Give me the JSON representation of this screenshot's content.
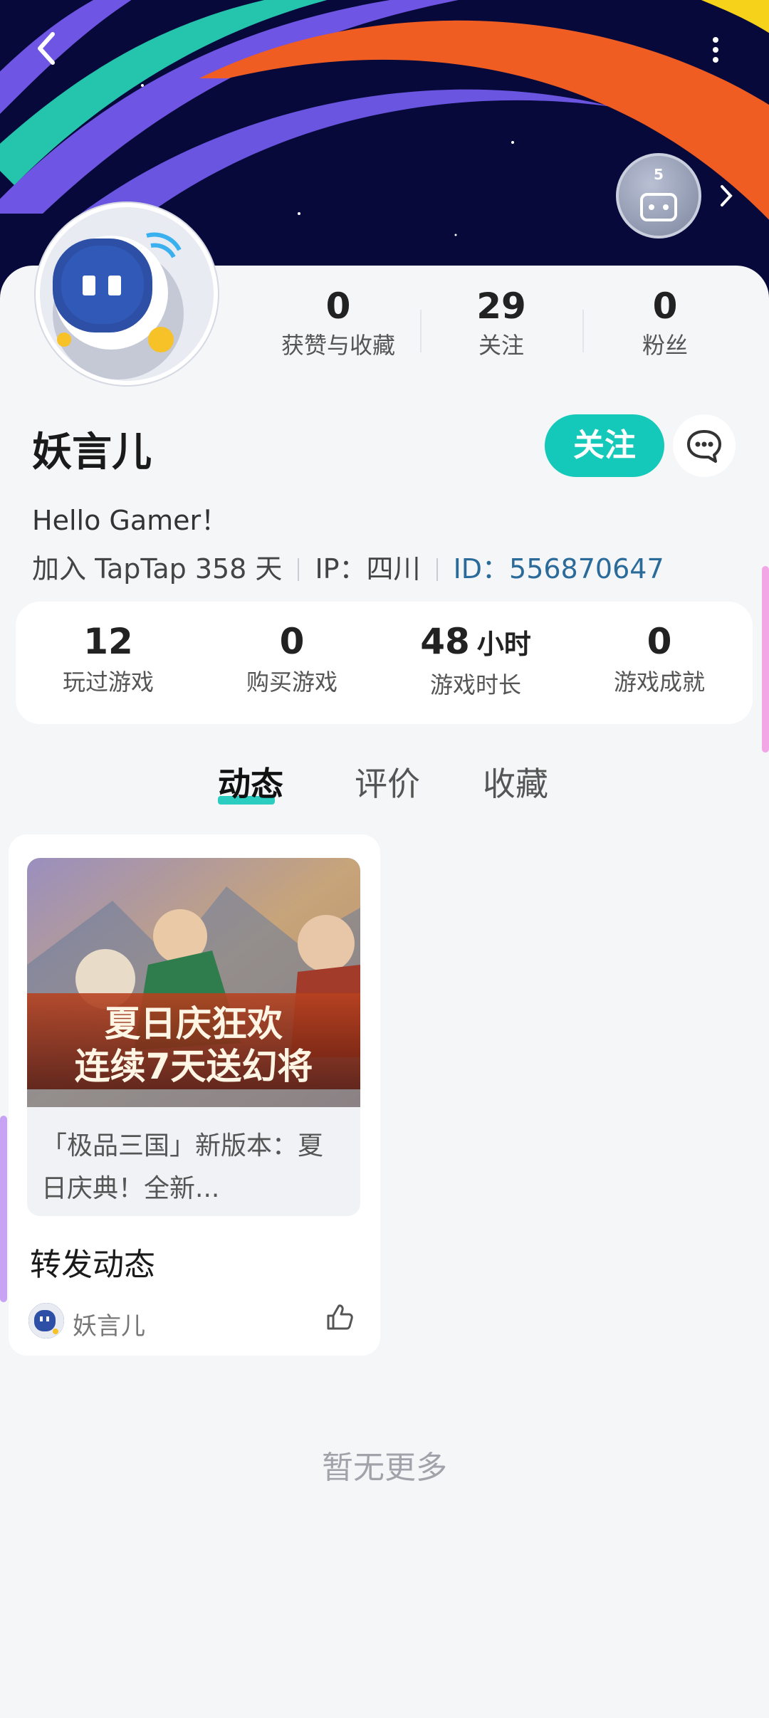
{
  "header": {
    "back_icon": "back-arrow-icon",
    "more_icon": "more-vertical-icon",
    "badge_level": "5",
    "badge_icon": "game-controller-icon",
    "chevron_icon": "chevron-right-icon"
  },
  "profile": {
    "username": "妖言儿",
    "bio": "Hello Gamer！",
    "joined": "加入 TapTap 358 天",
    "ip": "IP：四川",
    "id": "ID：556870647",
    "follow_label": "关注",
    "message_icon": "chat-bubble-icon"
  },
  "stats": [
    {
      "value": "0",
      "label": "获赞与收藏"
    },
    {
      "value": "29",
      "label": "关注"
    },
    {
      "value": "0",
      "label": "粉丝"
    }
  ],
  "game_stats": [
    {
      "value": "12",
      "unit": "",
      "label": "玩过游戏"
    },
    {
      "value": "0",
      "unit": "",
      "label": "购买游戏"
    },
    {
      "value": "48",
      "unit": "小时",
      "label": "游戏时长"
    },
    {
      "value": "0",
      "unit": "",
      "label": "游戏成就"
    }
  ],
  "tabs": [
    {
      "label": "动态",
      "active": true
    },
    {
      "label": "评价",
      "active": false
    },
    {
      "label": "收藏",
      "active": false
    }
  ],
  "post": {
    "image_text_line1": "夏日庆狂欢",
    "image_text_line2": "连续7天送幻将",
    "quote_text": "「极品三国」新版本：夏日庆典！全新...",
    "title": "转发动态",
    "author": "妖言儿",
    "like_icon": "thumbs-up-icon"
  },
  "footer": {
    "no_more": "暂无更多"
  },
  "colors": {
    "accent": "#14c9b9",
    "id_link": "#2b6b9a",
    "banner_bg": "#07093a"
  }
}
